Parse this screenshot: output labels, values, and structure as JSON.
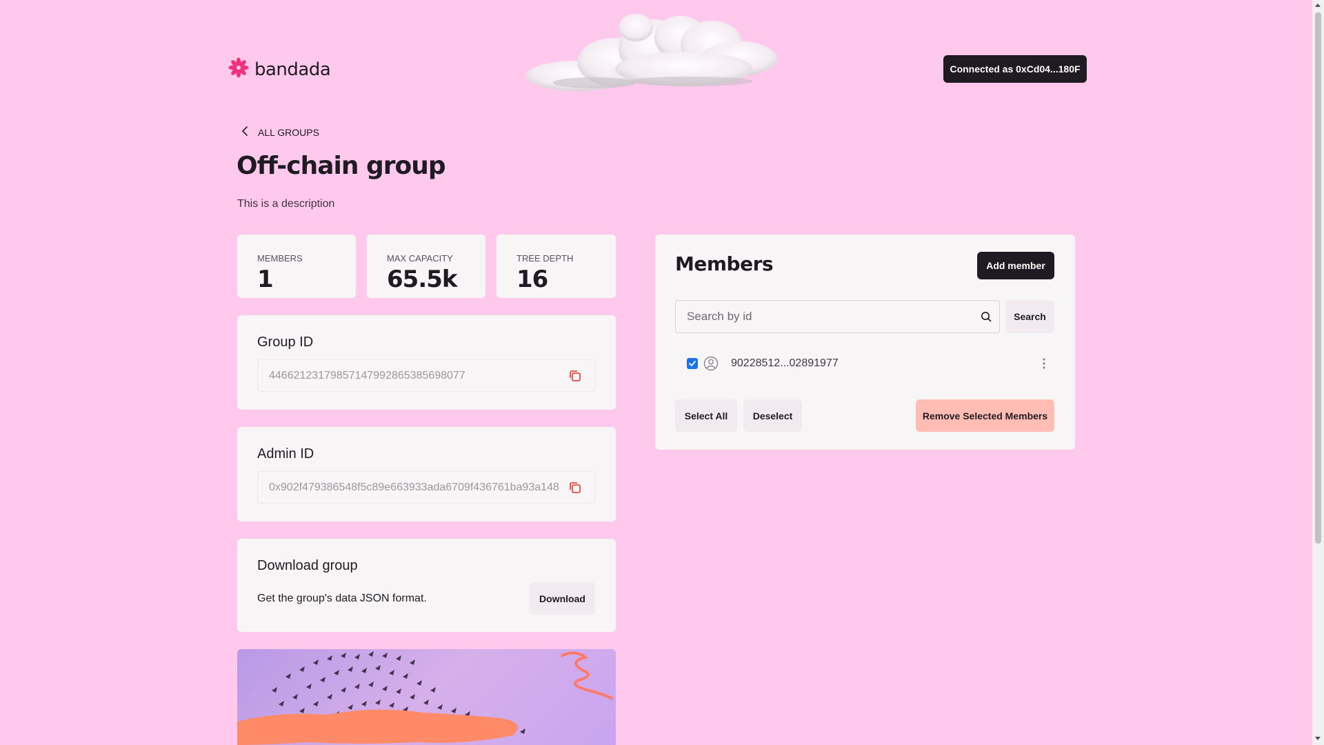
{
  "header": {
    "logo_text": "bandada",
    "connected_label": "Connected as 0xCd04...180F"
  },
  "nav": {
    "back_label": "ALL GROUPS"
  },
  "group": {
    "title": "Off-chain group",
    "description": "This is a description"
  },
  "stats": [
    {
      "label": "MEMBERS",
      "value": "1"
    },
    {
      "label": "MAX CAPACITY",
      "value": "65.5k"
    },
    {
      "label": "TREE DEPTH",
      "value": "16"
    }
  ],
  "group_id": {
    "title": "Group ID",
    "value": "44662123179857147992865385698077"
  },
  "admin_id": {
    "title": "Admin ID",
    "value": "0x902f479386548f5c89e663933ada6709f436761ba93a148"
  },
  "download": {
    "title": "Download group",
    "text": "Get the group's data JSON format.",
    "button_label": "Download"
  },
  "members": {
    "title": "Members",
    "add_label": "Add member",
    "search_placeholder": "Search by id",
    "search_label": "Search",
    "items": [
      {
        "id": "90228512...02891977",
        "checked": true
      }
    ],
    "select_all_label": "Select All",
    "deselect_label": "Deselect",
    "remove_label": "Remove Selected Members"
  },
  "colors": {
    "background": "#ffc9ee",
    "card": "#f7f5f6",
    "dark": "#1f1b22",
    "accent_logo": "#f0327a",
    "remove_button": "#ffbdb3",
    "copy_icon": "#e8483d",
    "checkbox": "#1a73e8"
  },
  "icons": [
    "bandada-logo-icon",
    "cloud-illustration",
    "chevron-left-icon",
    "copy-icon",
    "search-icon",
    "user-circle-icon",
    "kebab-menu-icon",
    "checkbox-checked-icon"
  ]
}
